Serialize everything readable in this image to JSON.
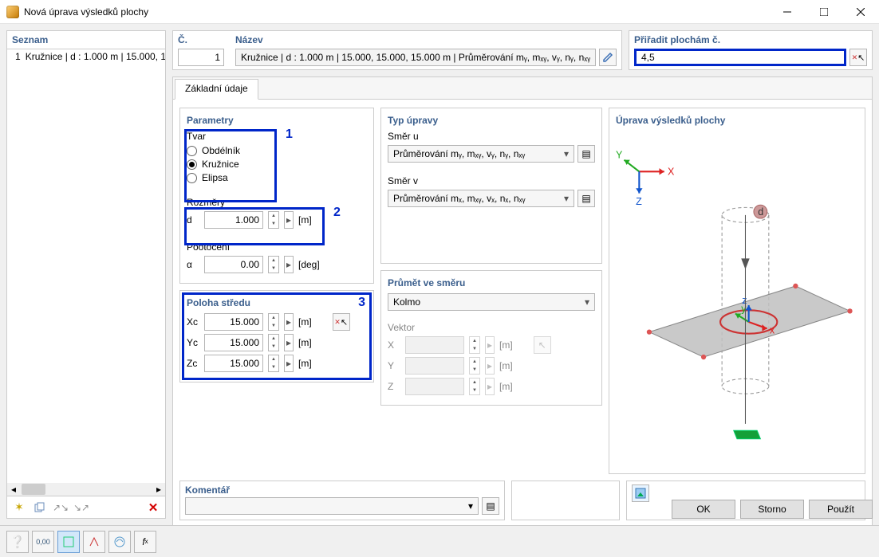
{
  "window": {
    "title": "Nová úprava výsledků plochy"
  },
  "seznam": {
    "header": "Seznam",
    "items": [
      {
        "n": "1",
        "label": "Kružnice | d : 1.000 m | 15.000, 1"
      }
    ]
  },
  "top": {
    "c_label": "Č.",
    "c_value": "1",
    "nazev_label": "Název",
    "nazev_value": "Kružnice | d : 1.000 m | 15.000, 15.000, 15.000 m | Průměrování mᵧ, mₓᵧ, vᵧ, nᵧ, nₓᵧ | Prům",
    "assign_label": "Přiřadit plochám č.",
    "assign_value": "4,5"
  },
  "tabs": {
    "t0": "Základní údaje"
  },
  "parametry": {
    "title": "Parametry",
    "tvar_label": "Tvar",
    "shape_rect": "Obdélník",
    "shape_circle": "Kružnice",
    "shape_ellipse": "Elipsa",
    "rozmery_label": "Rozměry",
    "d_label": "d",
    "d_value": "1.000",
    "d_unit": "[m]",
    "poot_label": "Pootočení",
    "a_label": "α",
    "a_value": "0.00",
    "a_unit": "[deg]"
  },
  "poloha": {
    "title": "Poloha středu",
    "xc_label": "Xc",
    "yc_label": "Yc",
    "zc_label": "Zc",
    "xc": "15.000",
    "yc": "15.000",
    "zc": "15.000",
    "unit": "[m]"
  },
  "typ": {
    "title": "Typ úpravy",
    "smer_u": "Směr u",
    "drop_u": "Průměrování mᵧ, mₓᵧ, vᵧ, nᵧ, nₓᵧ",
    "smer_v": "Směr v",
    "drop_v": "Průměrování mₓ, mₓᵧ, vₓ, nₓ, nₓᵧ"
  },
  "prumet": {
    "title": "Průmět ve směru",
    "drop": "Kolmo",
    "vektor_label": "Vektor",
    "x": "X",
    "y": "Y",
    "z": "Z",
    "unit": "[m]"
  },
  "preview": {
    "title": "Úprava výsledků plochy"
  },
  "komentar": {
    "title": "Komentář"
  },
  "buttons": {
    "ok": "OK",
    "cancel": "Storno",
    "apply": "Použít"
  },
  "annot": {
    "n1": "1",
    "n2": "2",
    "n3": "3"
  },
  "chart_data": {
    "type": "diagram",
    "description": "3D isometric preview of result adjustment: a circular region (d) on a gray surface plane intersected by a vertical cylinder, with global axes X (red, right), Y (green, up-left), Z (blue, down) at top-left, local axes at center, and a green base marker below."
  }
}
